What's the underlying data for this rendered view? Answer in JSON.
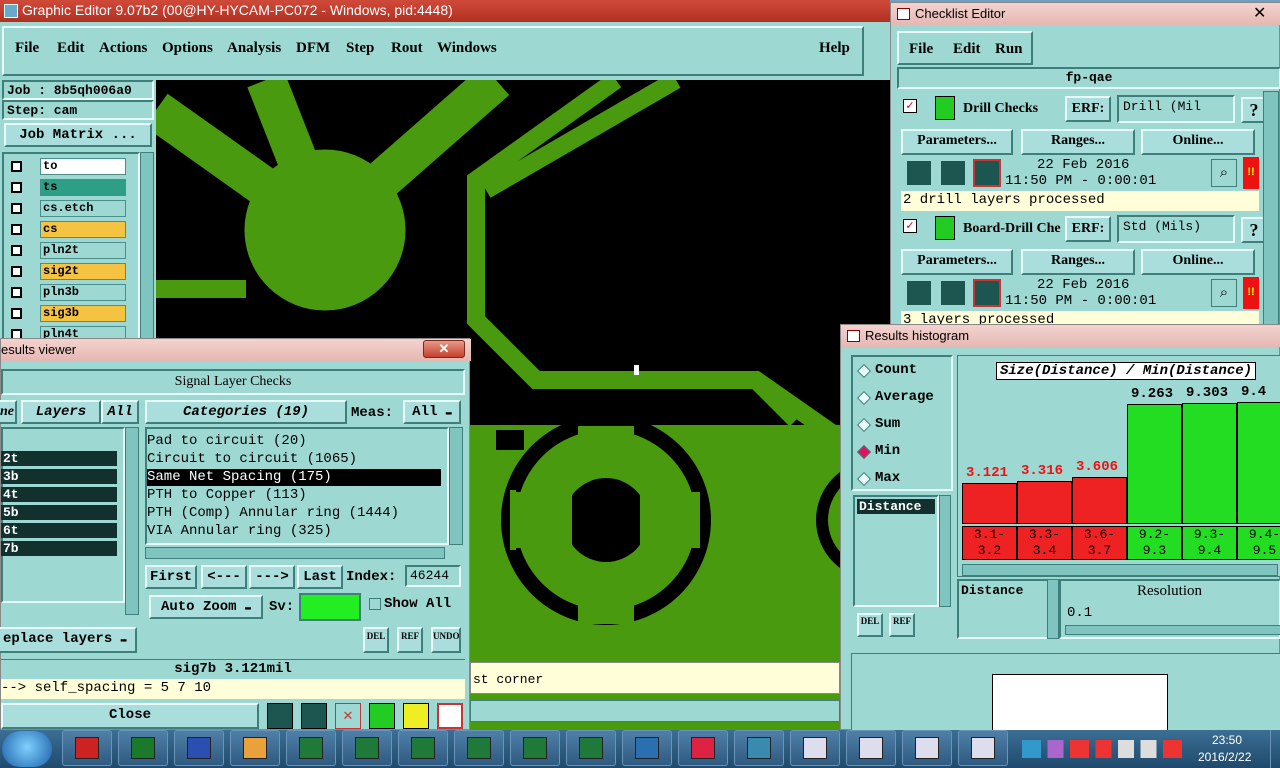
{
  "main_window": {
    "title": "Graphic Editor 9.07b2 (00@HY-HYCAM-PC072 - Windows, pid:4448)",
    "menu": [
      "File",
      "Edit",
      "Actions",
      "Options",
      "Analysis",
      "DFM",
      "Step",
      "Rout",
      "Windows"
    ],
    "help": "Help",
    "job_label": "Job : 8b5qh006a0",
    "step_label": "Step: cam",
    "job_matrix_button": "Job Matrix ...",
    "layers": [
      {
        "name": "to",
        "color": "#ffffff"
      },
      {
        "name": "ts",
        "color": "#2f9e86"
      },
      {
        "name": "cs.etch",
        "color": "#9ed8d3"
      },
      {
        "name": "cs",
        "color": "#f5c342"
      },
      {
        "name": "pln2t",
        "color": "#9ed8d3"
      },
      {
        "name": "sig2t",
        "color": "#f5c342"
      },
      {
        "name": "pln3b",
        "color": "#9ed8d3"
      },
      {
        "name": "sig3b",
        "color": "#f5c342"
      },
      {
        "name": "pln4t",
        "color": "#9ed8d3"
      }
    ],
    "status_line": "st corner"
  },
  "results_viewer": {
    "title": "esults viewer",
    "header": "Signal Layer Checks",
    "tab_left": "ne",
    "layers_tab": "Layers",
    "all_tab": "All",
    "categories_tab": "Categories (19)",
    "meas_label": "Meas:",
    "meas_value": "All",
    "layer_list": [
      "2t",
      "3b",
      "4t",
      "5b",
      "6t",
      "7b"
    ],
    "categories": [
      "Pad to circuit (20)",
      "Circuit to circuit (1065)",
      "Same Net Spacing (175)",
      "PTH to Copper (113)",
      "PTH (Comp) Annular ring (1444)",
      "VIA Annular ring (325)"
    ],
    "selected_category_index": 2,
    "first_button": "First",
    "prev_button": "<---",
    "next_button": "--->",
    "last_button": "Last",
    "index_label": "Index:",
    "index_value": "46244",
    "auto_zoom": "Auto Zoom",
    "sv_label": "Sv:",
    "show_all": "Show All",
    "replace_layers": "eplace layers",
    "del": "DEL",
    "ref": "REF",
    "undo": "UNDO",
    "result_line": "sig7b 3.121mil",
    "detail_line": "--> self_spacing = 5 7 10",
    "close_button": "Close"
  },
  "checklist_editor": {
    "title": "Checklist Editor",
    "menu": [
      "File",
      "Edit",
      "Run"
    ],
    "checklist_name": "fp-qae",
    "checks": [
      {
        "name": "Drill Checks",
        "erf_label": "ERF:",
        "erf_value": "Drill (Mil",
        "parameters": "Parameters...",
        "ranges": "Ranges...",
        "online": "Online...",
        "date": "22 Feb 2016",
        "time": "11:50 PM - 0:00:01",
        "status": "2 drill layers processed"
      },
      {
        "name": "Board-Drill Che",
        "erf_label": "ERF:",
        "erf_value": "Std (Mils)",
        "parameters": "Parameters...",
        "ranges": "Ranges...",
        "online": "Online...",
        "date": "22 Feb 2016",
        "time": "11:50 PM - 0:00:01",
        "status": "3 layers processed"
      }
    ],
    "help_glyph": "?",
    "alert_glyph": "!!"
  },
  "histogram": {
    "title": "Results histogram",
    "modes": [
      "Count",
      "Average",
      "Sum",
      "Min",
      "Max"
    ],
    "selected_mode": "Min",
    "list_item": "Distance",
    "chart_title": "Size(Distance) / Min(Distance)",
    "resolution_label": "Resolution",
    "resolution_value": "0.1",
    "distance_label": "Distance",
    "del": "DEL",
    "ref": "REF",
    "chart_data": {
      "type": "bar",
      "title": "Size(Distance) / Min(Distance)",
      "categories": [
        "3.1-3.2",
        "3.3-3.4",
        "3.6-3.7",
        "9.2-9.3",
        "9.3-9.4",
        "9.4-9.5"
      ],
      "range_top": [
        "3.1-",
        "3.3-",
        "3.6-",
        "9.2-",
        "9.3-",
        "9.4-"
      ],
      "range_bottom": [
        "3.2",
        "3.4",
        "3.7",
        "9.3",
        "9.4",
        "9.5"
      ],
      "values": [
        3.121,
        3.316,
        3.606,
        9.263,
        9.303,
        9.4
      ],
      "labels": [
        "3.121",
        "3.316",
        "3.606",
        "9.263",
        "9.303",
        "9.4"
      ],
      "colors": [
        "#ee2222",
        "#ee2222",
        "#ee2222",
        "#22dd22",
        "#22dd22",
        "#22dd22"
      ],
      "ylim": [
        0,
        9.4
      ]
    }
  },
  "taskbar": {
    "time": "23:50",
    "date": "2016/2/22"
  }
}
